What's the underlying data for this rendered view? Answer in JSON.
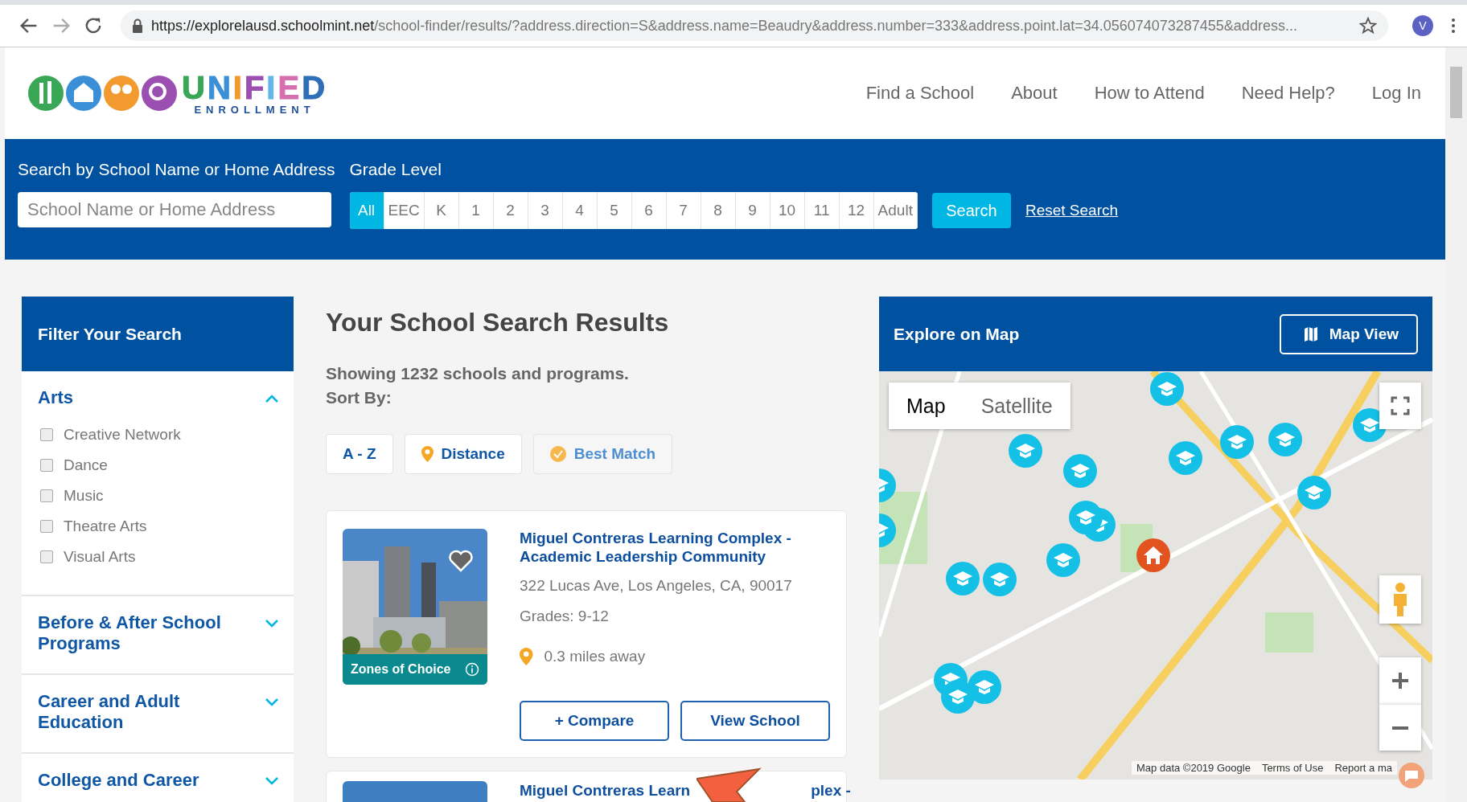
{
  "browser": {
    "url_host": "https://explorelausd.schoolmint.net",
    "url_path": "/school-finder/results/?address.direction=S&address.name=Beaudry&address.number=333&address.point.lat=34.056074073287455&address...",
    "profile_initial": "V"
  },
  "logo": {
    "title": "UNIFIED",
    "subtitle": "ENROLLMENT"
  },
  "nav": [
    "Find a School",
    "About",
    "How to Attend",
    "Need Help?",
    "Log In"
  ],
  "search": {
    "label": "Search by School Name or Home Address",
    "placeholder": "School Name or Home Address",
    "grade_label": "Grade Level",
    "grades": [
      {
        "label": "All",
        "selected": true
      },
      {
        "label": "EEC",
        "selected": false
      },
      {
        "label": "K",
        "selected": false
      },
      {
        "label": "1",
        "selected": false
      },
      {
        "label": "2",
        "selected": false
      },
      {
        "label": "3",
        "selected": false
      },
      {
        "label": "4",
        "selected": false
      },
      {
        "label": "5",
        "selected": false
      },
      {
        "label": "6",
        "selected": false
      },
      {
        "label": "7",
        "selected": false
      },
      {
        "label": "8",
        "selected": false
      },
      {
        "label": "9",
        "selected": false
      },
      {
        "label": "10",
        "selected": false
      },
      {
        "label": "11",
        "selected": false
      },
      {
        "label": "12",
        "selected": false
      },
      {
        "label": "Adult",
        "selected": false
      }
    ],
    "search_button": "Search",
    "reset_link": "Reset Search"
  },
  "filters": {
    "title": "Filter Your Search",
    "sections": [
      {
        "title": "Arts",
        "expanded": true,
        "options": [
          {
            "label": "Creative Network",
            "checked": false
          },
          {
            "label": "Dance",
            "checked": false
          },
          {
            "label": "Music",
            "checked": false
          },
          {
            "label": "Theatre Arts",
            "checked": false
          },
          {
            "label": "Visual Arts",
            "checked": false
          }
        ]
      },
      {
        "title": "Before & After School Programs",
        "expanded": false
      },
      {
        "title": "Career and Adult Education",
        "expanded": false
      },
      {
        "title": "College and Career",
        "expanded": false
      }
    ]
  },
  "results": {
    "title": "Your School Search Results",
    "summary": "Showing 1232 schools and programs.",
    "sort_label": "Sort By:",
    "sort_options": [
      {
        "label": "A - Z",
        "kind": "plain",
        "selected": false
      },
      {
        "label": "Distance",
        "kind": "pin",
        "selected": false
      },
      {
        "label": "Best Match",
        "kind": "check",
        "selected": true
      }
    ],
    "schools": [
      {
        "name": "Miguel Contreras Learning Complex - Academic Leadership Community",
        "address": "322 Lucas Ave, Los Angeles, CA, 90017",
        "grades": "Grades: 9-12",
        "distance": "0.3 miles away",
        "badge": "Zones of Choice",
        "compare_button": "+ Compare",
        "view_button": "View School"
      }
    ],
    "next_school": {
      "name_parts": [
        "Miguel Contreras Learn",
        "plex -"
      ]
    }
  },
  "map": {
    "title": "Explore on Map",
    "view_button": "Map View",
    "map_types": [
      {
        "label": "Map",
        "selected": true
      },
      {
        "label": "Satellite",
        "selected": false
      }
    ],
    "attribution": [
      "Map data ©2019 Google",
      "Terms of Use",
      "Report a ma"
    ]
  }
}
